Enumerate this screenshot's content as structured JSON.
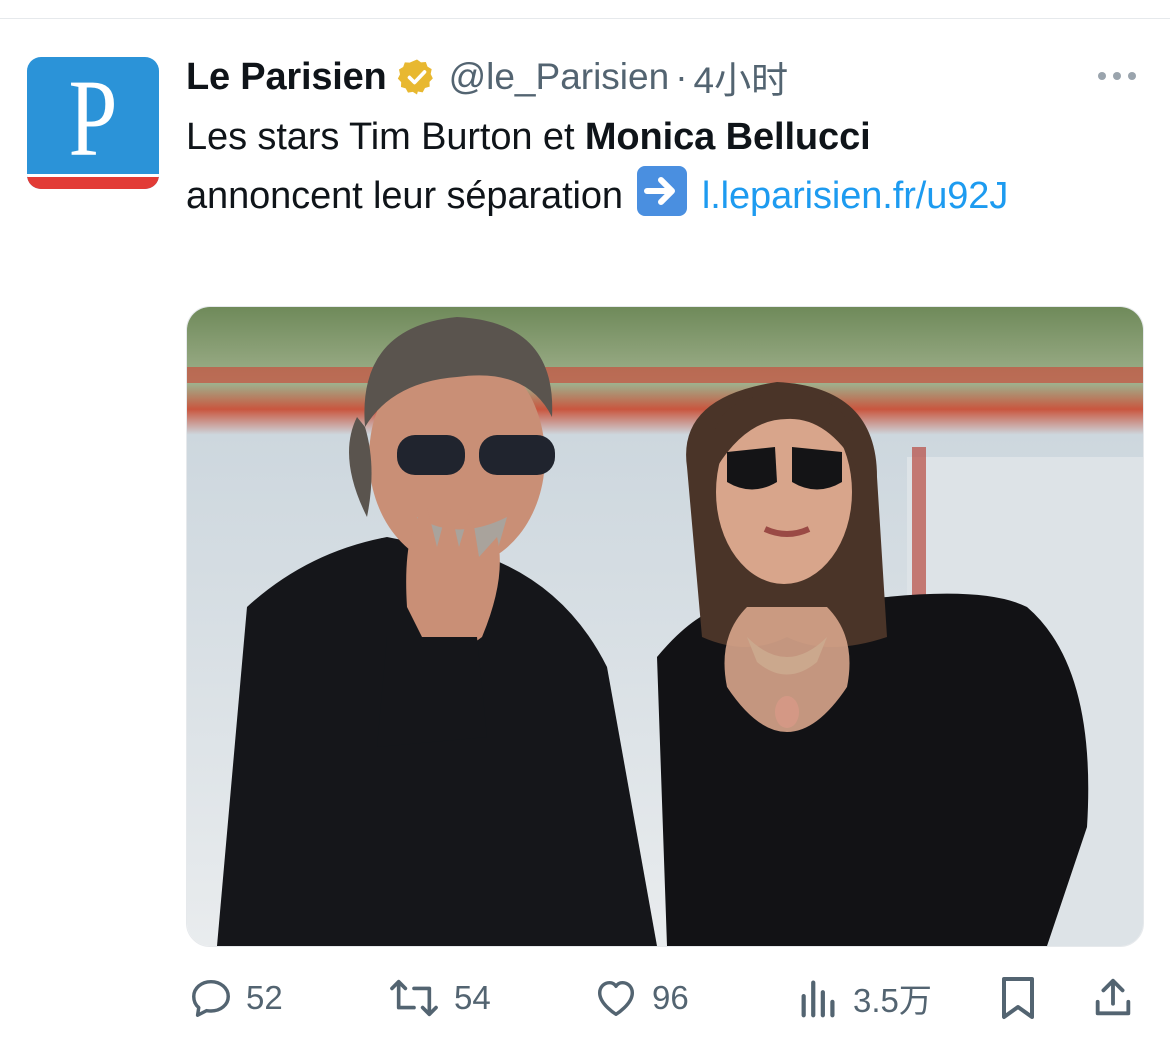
{
  "author": {
    "name": "Le Parisien",
    "handle": "@le_Parisien",
    "separator": "·",
    "time": "4小时",
    "avatar_letter": "P",
    "verified_icon": "verified-badge-icon"
  },
  "tweet": {
    "text_part1": "Les stars Tim Burton et ",
    "text_bold": "Monica Bellucci",
    "text_part2": " annoncent leur séparation ",
    "emoji": "arrow-right-emoji",
    "link_text": "l.leparisien.fr/u92J"
  },
  "media": {
    "type": "photo",
    "description_icon": "photo-image"
  },
  "actions": {
    "replies": "52",
    "retweets": "54",
    "likes": "96",
    "views": "3.5万"
  },
  "colors": {
    "link": "#1d9bf0",
    "secondary_text": "#536471",
    "avatar_blue": "#2b93d8",
    "avatar_red": "#e23b36",
    "verified_gold": "#e8b830"
  }
}
